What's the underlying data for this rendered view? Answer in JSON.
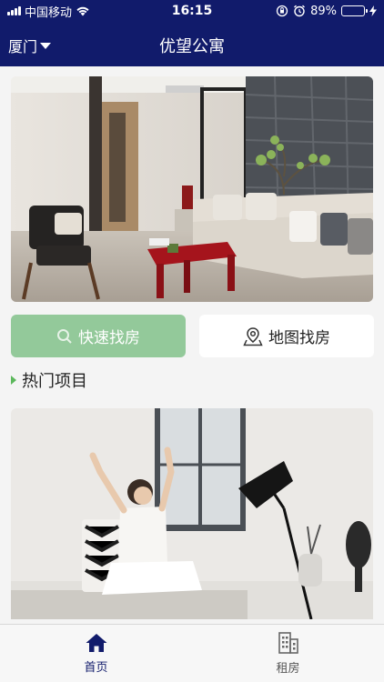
{
  "status_bar": {
    "carrier": "中国移动",
    "time": "16:15",
    "battery": "89%",
    "battery_level": 0.89
  },
  "header": {
    "city": "厦门",
    "title": "优望公寓"
  },
  "buttons": {
    "quick": "快速找房",
    "map": "地图找房"
  },
  "section": {
    "title": "热门项目"
  },
  "tabbar": {
    "home": "首页",
    "rent": "租房"
  },
  "colors": {
    "nav_bg": "#111b6b",
    "quick_btn": "#93c99a",
    "accent_green": "#5cb85c",
    "active_tab": "#111b6b"
  }
}
